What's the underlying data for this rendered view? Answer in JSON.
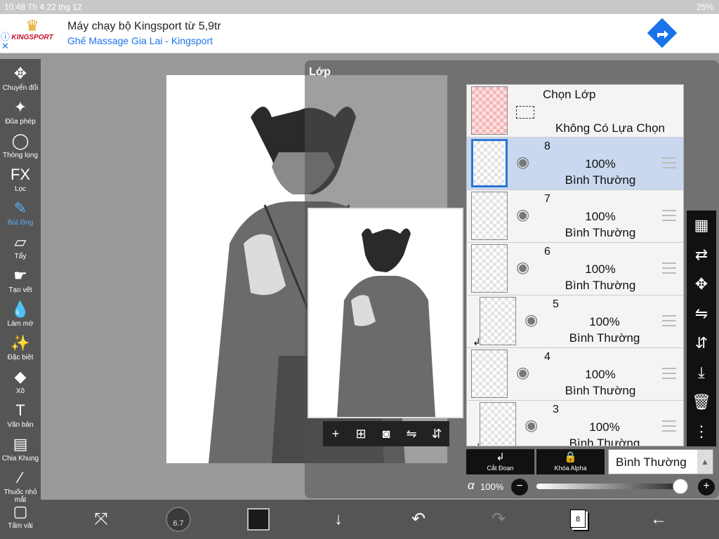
{
  "status": {
    "time": "10:48",
    "date": "Th 4 22 thg 12",
    "battery": "25%"
  },
  "ad": {
    "brand": "KINGSPORT",
    "headline": "Máy chạy bộ Kingsport từ 5,9tr",
    "subline": "Ghế Massage Gia Lai - Kingsport"
  },
  "tools": [
    {
      "label": "Chuyển đổi",
      "icon": "move-icon"
    },
    {
      "label": "Đũa phép",
      "icon": "magic-wand-icon"
    },
    {
      "label": "Thòng lọng",
      "icon": "lasso-icon"
    },
    {
      "label": "Lọc",
      "icon": "fx-icon",
      "glyph": "FX"
    },
    {
      "label": "Bút lông",
      "icon": "brush-icon",
      "active": true
    },
    {
      "label": "Tẩy",
      "icon": "eraser-icon"
    },
    {
      "label": "Tạo vết",
      "icon": "smudge-icon"
    },
    {
      "label": "Làm mờ",
      "icon": "blur-icon"
    },
    {
      "label": "Đặc biệt",
      "icon": "special-icon"
    },
    {
      "label": "Xô",
      "icon": "bucket-icon"
    },
    {
      "label": "Văn bản",
      "icon": "text-icon",
      "glyph": "T"
    },
    {
      "label": "Chia Khung",
      "icon": "frame-divider-icon"
    },
    {
      "label": "Thuốc nhỏ mắt",
      "icon": "eyedropper-icon"
    },
    {
      "label": "Tấm vải",
      "icon": "canvas-icon"
    }
  ],
  "layer_panel": {
    "title": "Lớp",
    "selection_layer": {
      "label": "Chọn Lớp",
      "value": "Không Có Lựa Chọn"
    },
    "layers": [
      {
        "num": "8",
        "opacity": "100%",
        "mode": "Bình Thường",
        "selected": true,
        "clipped": false
      },
      {
        "num": "7",
        "opacity": "100%",
        "mode": "Bình Thường",
        "selected": false,
        "clipped": false
      },
      {
        "num": "6",
        "opacity": "100%",
        "mode": "Bình Thường",
        "selected": false,
        "clipped": false
      },
      {
        "num": "5",
        "opacity": "100%",
        "mode": "Bình Thường",
        "selected": false,
        "clipped": true
      },
      {
        "num": "4",
        "opacity": "100%",
        "mode": "Bình Thường",
        "selected": false,
        "clipped": false
      },
      {
        "num": "3",
        "opacity": "100%",
        "mode": "Bình Thường",
        "selected": false,
        "clipped": true
      }
    ],
    "cut_label": "Cắt Đoạn",
    "alpha_lock_label": "Khóa Alpha",
    "blend_mode": "Bình Thường",
    "opacity_label": "α",
    "opacity_value": "100%",
    "opacity_fraction": 1.0
  },
  "bottom": {
    "brush_size": "6.7",
    "layer_count": "8",
    "brush_color": "#1a1a1a"
  }
}
